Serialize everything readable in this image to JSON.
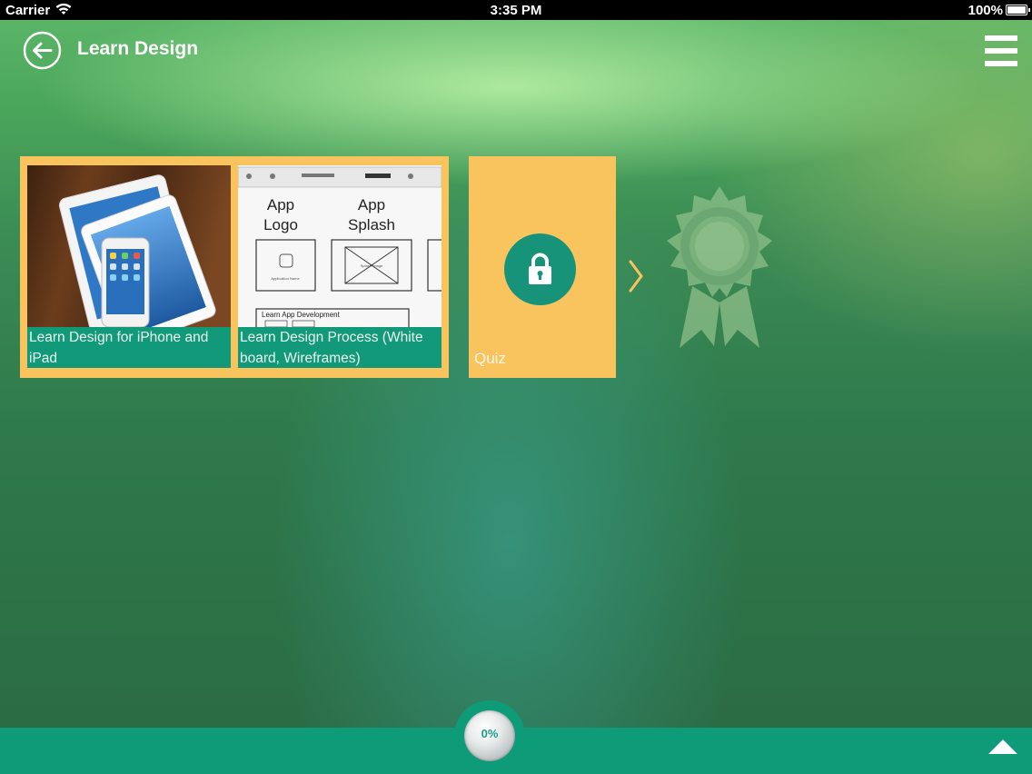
{
  "status_bar": {
    "carrier": "Carrier",
    "time": "3:35 PM",
    "battery": "100%"
  },
  "header": {
    "title": "Learn Design",
    "back_icon": "back-arrow-icon",
    "menu_icon": "hamburger-menu-icon"
  },
  "lessons": [
    {
      "title": "Learn Design for iPhone and iPad",
      "thumbnail": "ipad-iphone-devices"
    },
    {
      "title": "Learn Design Process (White board, Wireframes)",
      "thumbnail": "wireframe-sketch"
    }
  ],
  "wireframe_text": {
    "app_logo": "App Logo",
    "app_splash": "App Splash",
    "app_logo_box": "Application Name",
    "splash_box": "Splash Image",
    "bottom_label": "Learn App Development"
  },
  "quiz": {
    "label": "Quiz",
    "locked": true,
    "icon": "lock-icon"
  },
  "badge": {
    "icon": "award-ribbon-icon"
  },
  "bottom_bar": {
    "progress": "0%",
    "progress_value": 0,
    "up_icon": "caret-up-icon"
  },
  "colors": {
    "tile_yellow": "#f9c45e",
    "teal": "#12997a",
    "bottom_bar": "#0e9c78"
  }
}
